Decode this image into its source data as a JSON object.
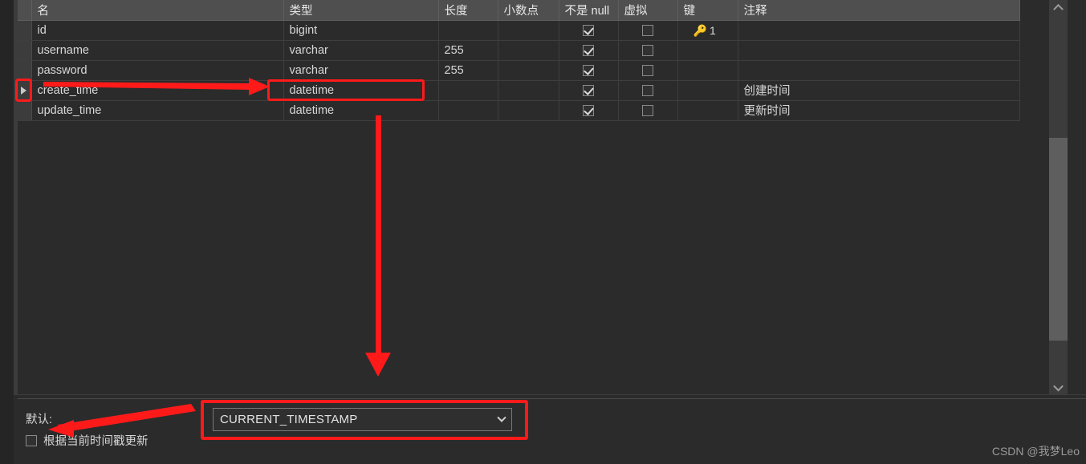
{
  "table": {
    "columns": [
      {
        "key": "name",
        "label": "名"
      },
      {
        "key": "type",
        "label": "类型"
      },
      {
        "key": "length",
        "label": "长度"
      },
      {
        "key": "decimal",
        "label": "小数点"
      },
      {
        "key": "notnull",
        "label": "不是 null"
      },
      {
        "key": "virtual",
        "label": "虚拟"
      },
      {
        "key": "key",
        "label": "键"
      },
      {
        "key": "comment",
        "label": "注释"
      }
    ],
    "rows": [
      {
        "selected": false,
        "name": "id",
        "type": "bigint",
        "length": "",
        "decimal": "",
        "notnull": true,
        "virtual": false,
        "key_icon": "key-icon",
        "key": "1",
        "comment": ""
      },
      {
        "selected": false,
        "name": "username",
        "type": "varchar",
        "length": "255",
        "decimal": "",
        "notnull": true,
        "virtual": false,
        "key_icon": "",
        "key": "",
        "comment": ""
      },
      {
        "selected": false,
        "name": "password",
        "type": "varchar",
        "length": "255",
        "decimal": "",
        "notnull": true,
        "virtual": false,
        "key_icon": "",
        "key": "",
        "comment": ""
      },
      {
        "selected": true,
        "name": "create_time",
        "type": "datetime",
        "length": "",
        "decimal": "",
        "notnull": true,
        "virtual": false,
        "key_icon": "",
        "key": "",
        "comment": "创建时间"
      },
      {
        "selected": false,
        "name": "update_time",
        "type": "datetime",
        "length": "",
        "decimal": "",
        "notnull": true,
        "virtual": false,
        "key_icon": "",
        "key": "",
        "comment": "更新时间"
      }
    ]
  },
  "bottom_panel": {
    "default_label": "默认:",
    "update_on_timestamp_label": "根据当前时间戳更新",
    "update_on_timestamp_checked": false,
    "default_value": "CURRENT_TIMESTAMP"
  },
  "scrollbar": {
    "up_icon": "chevron-up-icon",
    "down_icon": "chevron-down-icon"
  },
  "annotations": {
    "accent_color": "#ff1a1a"
  },
  "watermark": "CSDN @我梦Leo"
}
